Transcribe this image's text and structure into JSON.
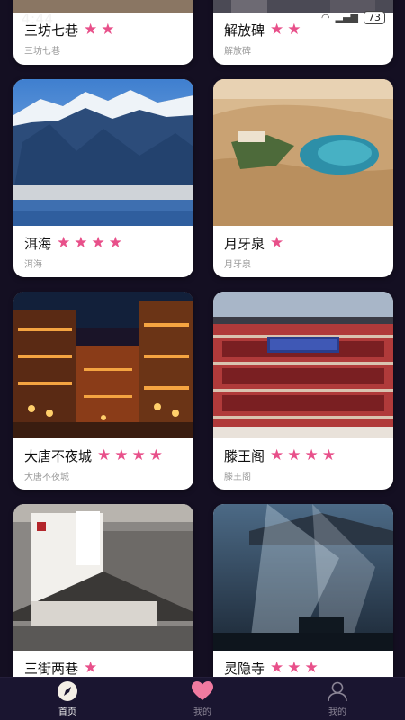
{
  "status_bar": {
    "time": "4:44",
    "battery": "73",
    "signal_glyph": "▂▄▆",
    "wifi_glyph": "◠"
  },
  "cards": [
    {
      "title": "三坊七巷",
      "subtitle": "三坊七巷",
      "stars": 2,
      "image": "old-street-photo"
    },
    {
      "title": "解放碑",
      "subtitle": "解放碑",
      "stars": 2,
      "image": "city-monument-photo"
    },
    {
      "title": "洱海",
      "subtitle": "洱海",
      "stars": 4,
      "image": "snow-mountain-lake-photo"
    },
    {
      "title": "月牙泉",
      "subtitle": "月牙泉",
      "stars": 1,
      "image": "desert-oasis-photo"
    },
    {
      "title": "大唐不夜城",
      "subtitle": "大唐不夜城",
      "stars": 4,
      "image": "night-lantern-street-photo"
    },
    {
      "title": "滕王阁",
      "subtitle": "滕王阁",
      "stars": 4,
      "image": "pavilion-photo"
    },
    {
      "title": "三街两巷",
      "subtitle": "",
      "stars": 1,
      "image": "white-wall-lane-photo"
    },
    {
      "title": "灵隐寺",
      "subtitle": "",
      "stars": 3,
      "image": "misty-temple-photo"
    }
  ],
  "star_glyph": "★",
  "nav": {
    "items": [
      {
        "label": "首页",
        "icon": "compass-icon",
        "active": true
      },
      {
        "label": "我的",
        "icon": "heart-icon",
        "active": false
      },
      {
        "label": "我的",
        "icon": "person-icon",
        "active": false
      }
    ]
  },
  "colors": {
    "background": "#140f22",
    "star": "#e8508a",
    "nav_bg": "#1a1530",
    "heart": "#f07aa0"
  }
}
